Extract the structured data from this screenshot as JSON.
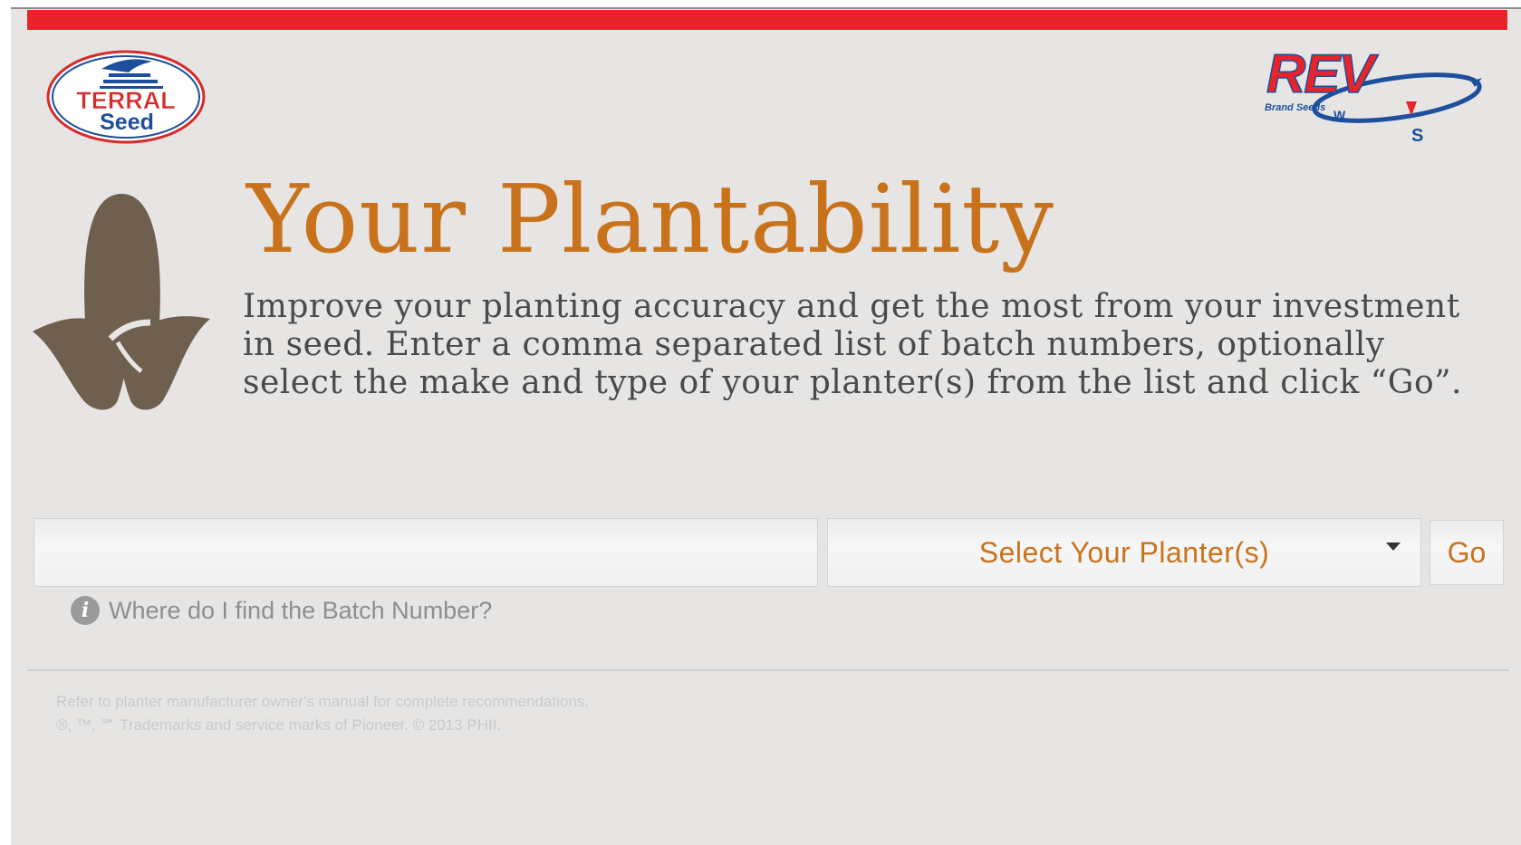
{
  "header": {
    "left_logo": {
      "name": "terral-seed-logo",
      "text_line1": "TERRAL",
      "text_line2": "Seed"
    },
    "right_logo": {
      "name": "rev-brand-seeds-logo",
      "text": "REV",
      "subtext": "Brand Seeds",
      "compass_w": "W",
      "compass_s": "S"
    }
  },
  "colors": {
    "accent_red": "#e8232a",
    "title_orange": "#c8731c",
    "icon_brown": "#6f5f4f",
    "background": "#e6e5e4",
    "terral_blue": "#1d4f9c",
    "terral_red": "#d62b2b"
  },
  "main": {
    "icon": "corn-kernel-icon",
    "title": "Your Plantability",
    "intro": "Improve your planting accuracy and get the most from your investment in seed. Enter a comma separated list of batch numbers, optionally select the make and type of your planter(s) from the list and click “Go”."
  },
  "form": {
    "batch_input": {
      "value": "",
      "placeholder": ""
    },
    "planter_select": {
      "selected": "Select Your Planter(s)"
    },
    "go_label": "Go",
    "help_icon": "info-icon",
    "help_text": "Where do I find the Batch Number?"
  },
  "footer": {
    "line1": "Refer to planter manufacturer owner's manual for complete recommendations.",
    "line2": "®, ™, ℠ Trademarks and service marks of Pioneer. © 2013 PHII."
  }
}
